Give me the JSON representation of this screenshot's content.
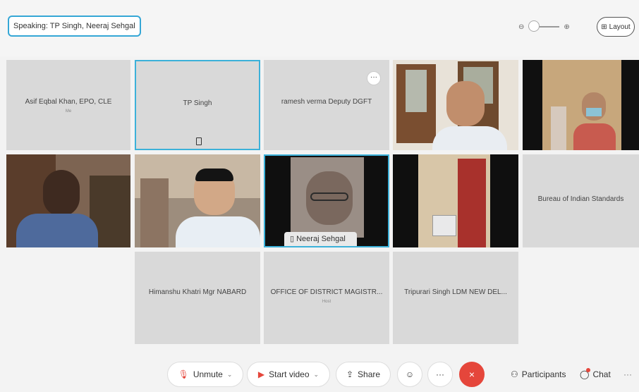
{
  "header": {
    "speaking": "Speaking: TP Singh, Neeraj Sehgal",
    "zoom_min_icon": "zoom-out-icon",
    "zoom_max_icon": "zoom-in-icon",
    "layout_label": "Layout"
  },
  "tiles": [
    {
      "name": "Asif Eqbal Khan, EPO, CLE",
      "sub": "Me"
    },
    {
      "name": "TP Singh"
    },
    {
      "name": "ramesh verma Deputy DGFT",
      "more": "···"
    },
    {
      "name": "Bureau of Indian Standards"
    },
    {
      "name": "Neeraj Sehgal"
    },
    {
      "name": "Himanshu Khatri Mgr NABARD"
    },
    {
      "name": "OFFICE OF DISTRICT MAGISTR...",
      "sub": "Host"
    },
    {
      "name": "Tripurari Singh LDM NEW DEL..."
    }
  ],
  "controls": {
    "unmute": "Unmute",
    "start_video": "Start video",
    "share": "Share",
    "reactions_icon": "emoji-icon",
    "more": "···",
    "leave": "×",
    "participants": "Participants",
    "chat": "Chat",
    "overflow": "···"
  }
}
